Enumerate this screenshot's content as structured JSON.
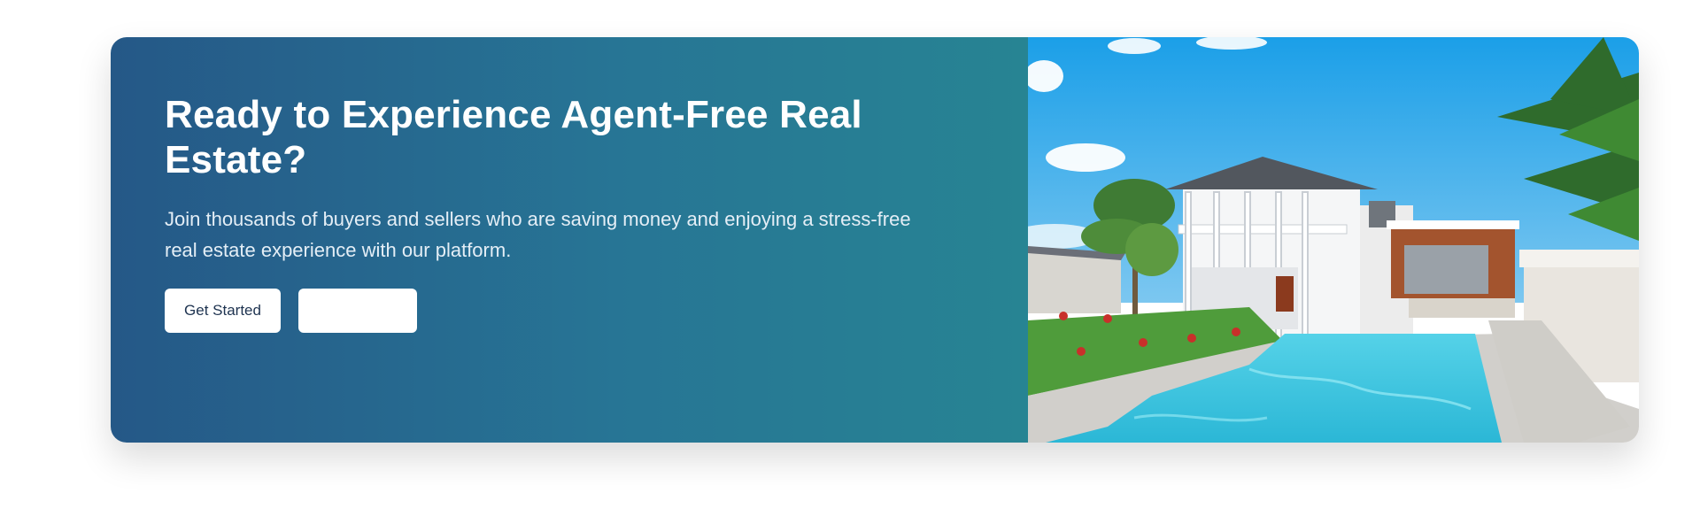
{
  "cta": {
    "title": "Ready to Experience Agent-Free Real Estate?",
    "subtitle": "Join thousands of buyers and sellers who are saving money and enjoying a stress-free real estate experience with our platform.",
    "primary_button": "Get Started",
    "secondary_button": ""
  },
  "colors": {
    "gradient_start": "#255887",
    "gradient_end": "#278493",
    "button_bg": "#ffffff",
    "button_text": "#1e3350"
  }
}
